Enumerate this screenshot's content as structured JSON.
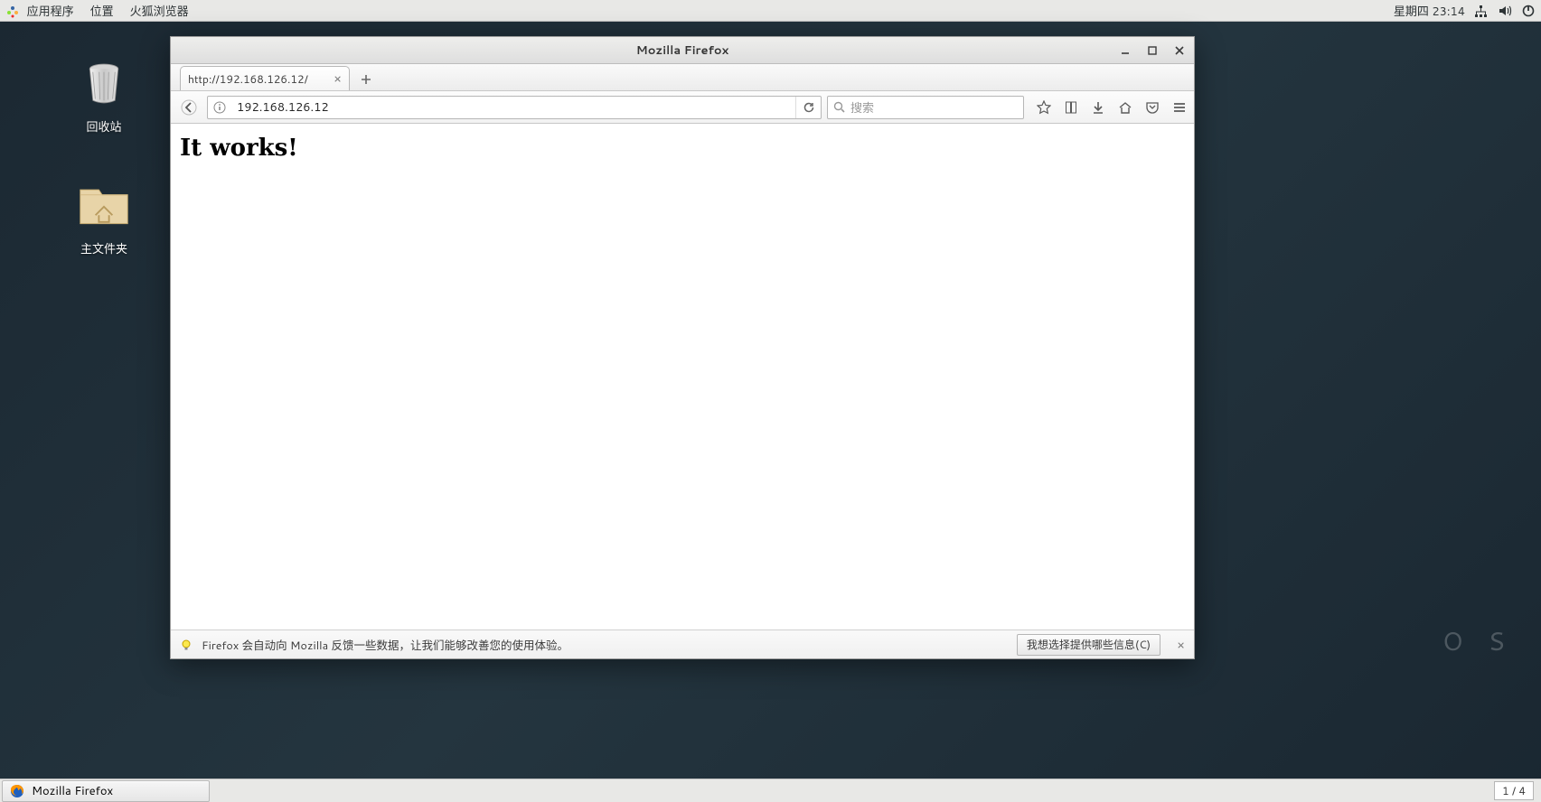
{
  "panel": {
    "applications": "应用程序",
    "places": "位置",
    "firefox_menu": "火狐浏览器",
    "clock": "星期四 23:14"
  },
  "desktop": {
    "trash_label": "回收站",
    "home_label": "主文件夹"
  },
  "os_watermark": "O S",
  "firefox": {
    "window_title": "Mozilla Firefox",
    "tab_title": "http://192.168.126.12/",
    "url_value": "192.168.126.12",
    "search_placeholder": "搜索",
    "page_heading": "It works!",
    "notify_text": "Firefox 会自动向 Mozilla 反馈一些数据，让我们能够改善您的使用体验。",
    "notify_button": "我想选择提供哪些信息(C)"
  },
  "taskbar": {
    "firefox_task": "Mozilla Firefox",
    "workspace": "1 / 4"
  }
}
